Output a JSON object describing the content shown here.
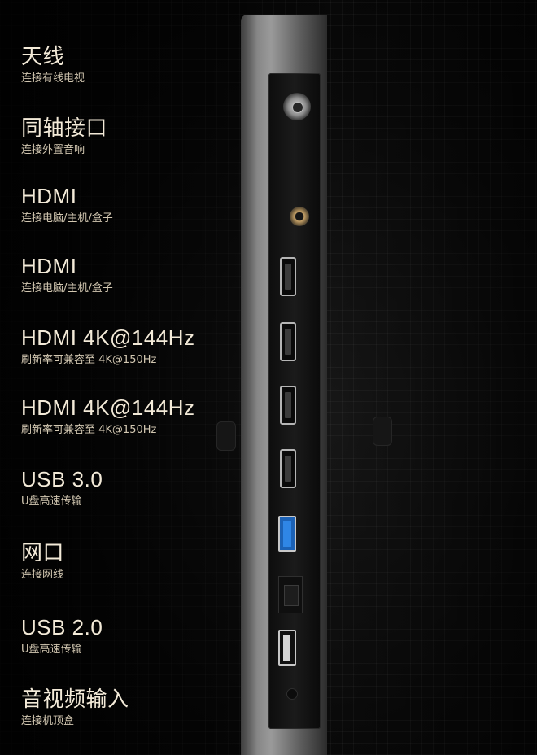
{
  "ports": [
    {
      "title": "天线",
      "subtitle": "连接有线电视",
      "icon": "antenna-port"
    },
    {
      "title": "同轴接口",
      "subtitle": "连接外置音响",
      "icon": "coaxial-port"
    },
    {
      "title": "HDMI",
      "subtitle": "连接电脑/主机/盒子",
      "icon": "hdmi-port"
    },
    {
      "title": "HDMI",
      "subtitle": "连接电脑/主机/盒子",
      "icon": "hdmi-port"
    },
    {
      "title": "HDMI 4K@144Hz",
      "subtitle": "刷新率可兼容至 4K@150Hz",
      "icon": "hdmi-port"
    },
    {
      "title": "HDMI 4K@144Hz",
      "subtitle": "刷新率可兼容至 4K@150Hz",
      "icon": "hdmi-port"
    },
    {
      "title": "USB 3.0",
      "subtitle": "U盘高速传输",
      "icon": "usb3-port"
    },
    {
      "title": "网口",
      "subtitle": "连接网线",
      "icon": "ethernet-port"
    },
    {
      "title": "USB 2.0",
      "subtitle": "U盘高速传输",
      "icon": "usb2-port"
    },
    {
      "title": "音视频输入",
      "subtitle": "连接机顶盒",
      "icon": "av-input-port"
    }
  ],
  "colors": {
    "title_text": "#f3ead8",
    "subtitle_text": "#d2c7b1",
    "background": "#050505",
    "usb3_blue": "#1c62b6"
  }
}
